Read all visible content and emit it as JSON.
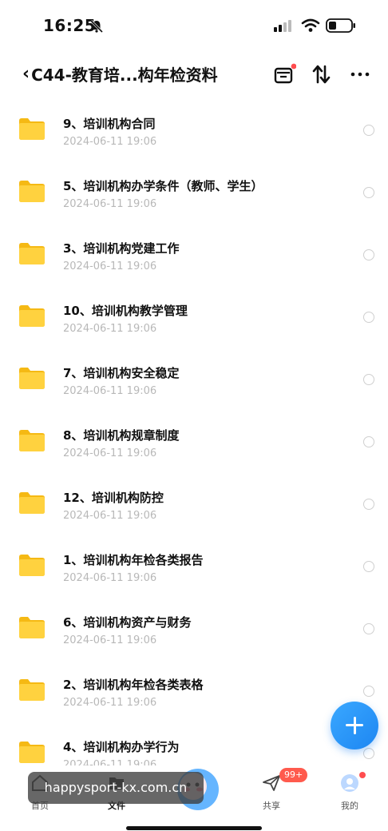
{
  "status_bar": {
    "time": "16:25"
  },
  "header": {
    "title": "C44-教育培...构年检资料"
  },
  "files": [
    {
      "name": "9、培训机构合同",
      "date": "2024-06-11 19:06"
    },
    {
      "name": "5、培训机构办学条件（教师、学生）",
      "date": "2024-06-11 19:06"
    },
    {
      "name": "3、培训机构党建工作",
      "date": "2024-06-11 19:06"
    },
    {
      "name": "10、培训机构教学管理",
      "date": "2024-06-11 19:06"
    },
    {
      "name": "7、培训机构安全稳定",
      "date": "2024-06-11 19:06"
    },
    {
      "name": "8、培训机构规章制度",
      "date": "2024-06-11 19:06"
    },
    {
      "name": "12、培训机构防控",
      "date": "2024-06-11 19:06"
    },
    {
      "name": "1、培训机构年检各类报告",
      "date": "2024-06-11 19:06"
    },
    {
      "name": "6、培训机构资产与财务",
      "date": "2024-06-11 19:06"
    },
    {
      "name": "2、培训机构年检各类表格",
      "date": "2024-06-11 19:06"
    },
    {
      "name": "4、培训机构办学行为",
      "date": "2024-06-11 19:06"
    }
  ],
  "bottom_nav": {
    "home": "首页",
    "files": "文件",
    "share": "共享",
    "share_badge": "99+",
    "mine": "我的"
  },
  "watermark": "happysport-kx.com.cn",
  "colors": {
    "accent": "#1d86f2",
    "folder": "#ffcc33",
    "badge": "#ff5a4d"
  }
}
